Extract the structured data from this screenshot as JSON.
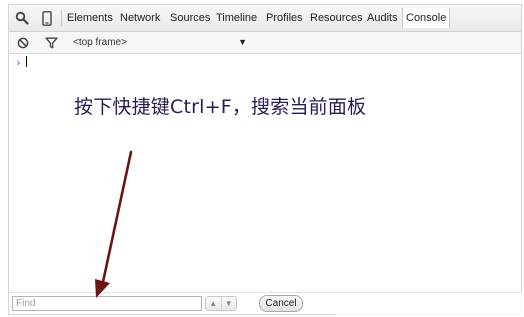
{
  "toolbar": {
    "icons": [
      "magnifier-icon",
      "device-icon"
    ],
    "tabs": [
      {
        "label": "Elements"
      },
      {
        "label": "Network"
      },
      {
        "label": "Sources"
      },
      {
        "label": "Timeline"
      },
      {
        "label": "Profiles"
      },
      {
        "label": "Resources"
      },
      {
        "label": "Audits"
      },
      {
        "label": "Console"
      }
    ],
    "active_tab": "Console"
  },
  "console_bar": {
    "icons": [
      "clear-console-icon",
      "filter-icon"
    ],
    "frame_selector": "<top frame>",
    "frame_selector_arrow": "▼"
  },
  "console": {
    "prompt": "›"
  },
  "annotation": {
    "text": "按下快捷键Ctrl+F，搜索当前面板",
    "color": "#2d1a52",
    "arrow_color": "#6b1414"
  },
  "findbar": {
    "placeholder": "Find",
    "value": "",
    "prev_arrow": "▲",
    "next_arrow": "▼",
    "cancel_label": "Cancel"
  }
}
